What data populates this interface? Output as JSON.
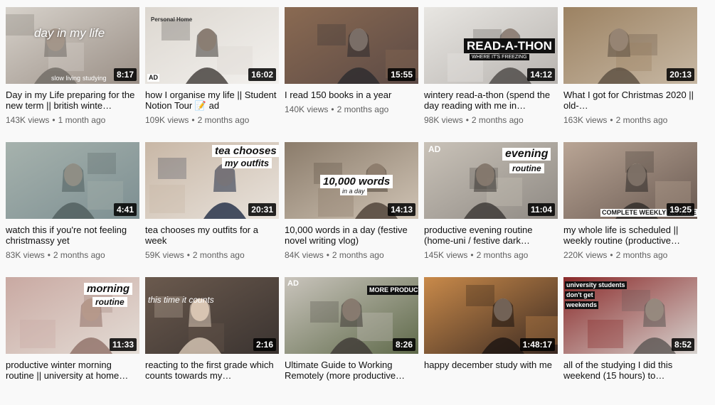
{
  "videos": [
    {
      "title": "Day in my Life preparing for the new term || british winte…",
      "views": "143K views",
      "age": "1 month ago",
      "duration": "8:17",
      "overlays": [
        "day in my life",
        "slow living",
        "studying"
      ],
      "palette": [
        "#9a8f86",
        "#d7d2cb",
        "#6f6a64"
      ]
    },
    {
      "title": "how I organise my life || Student Notion Tour 📝 ad",
      "views": "109K views",
      "age": "2 months ago",
      "duration": "16:02",
      "overlays": [
        "Personal Home",
        "AD"
      ],
      "palette": [
        "#f3f1ee",
        "#dcd7d0",
        "#3e3a36"
      ]
    },
    {
      "title": "I read 150 books in a year",
      "views": "140K views",
      "age": "2 months ago",
      "duration": "15:55",
      "overlays": [],
      "palette": [
        "#5c4a45",
        "#8a6a52",
        "#2c2a2e"
      ]
    },
    {
      "title": "wintery read-a-thon (spend the day reading with me in…",
      "views": "98K views",
      "age": "2 months ago",
      "duration": "14:12",
      "overlays": [
        "READ-A-THON",
        "WHERE IT'S FREEZING"
      ],
      "palette": [
        "#b8b4b0",
        "#e8e6e2",
        "#4a4644"
      ]
    },
    {
      "title": "What I got for Christmas 2020 || old-…",
      "views": "163K views",
      "age": "2 months ago",
      "duration": "20:13",
      "overlays": [],
      "palette": [
        "#c7b8a4",
        "#9c8262",
        "#5a4d40"
      ]
    },
    {
      "title": "watch this if you're not feeling christmassy yet",
      "views": "83K views",
      "age": "2 months ago",
      "duration": "4:41",
      "overlays": [],
      "palette": [
        "#7d8f92",
        "#a6b2ad",
        "#4f5d5c"
      ]
    },
    {
      "title": "tea chooses my outfits for a week",
      "views": "59K views",
      "age": "2 months ago",
      "duration": "20:31",
      "overlays": [
        "tea chooses",
        "my outfits"
      ],
      "palette": [
        "#e9e3dc",
        "#c8b7a6",
        "#1e2a44"
      ]
    },
    {
      "title": "10,000 words in a day (festive novel writing vlog)",
      "views": "84K views",
      "age": "2 months ago",
      "duration": "14:13",
      "overlays": [
        "10,000 words",
        "in a day"
      ],
      "palette": [
        "#cfc3b4",
        "#8b7c6b",
        "#4b3f35"
      ]
    },
    {
      "title": "productive evening routine (home-uni / festive dark…",
      "views": "145K views",
      "age": "2 months ago",
      "duration": "11:04",
      "overlays": [
        "AD",
        "evening",
        "routine"
      ],
      "palette": [
        "#8f8a84",
        "#c9c2b8",
        "#3a3633"
      ]
    },
    {
      "title": "my whole life is scheduled || weekly routine (productive…",
      "views": "220K views",
      "age": "2 months ago",
      "duration": "19:25",
      "overlays": [
        "COMPLETE WEEKLY ROUTINE"
      ],
      "palette": [
        "#6a5a52",
        "#b9a595",
        "#2e2a28"
      ]
    },
    {
      "title": "productive winter morning routine || university at home…",
      "views": "",
      "age": "",
      "duration": "11:33",
      "overlays": [
        "morning",
        "routine"
      ],
      "palette": [
        "#e4ddd6",
        "#c9a9a2",
        "#8f6f66"
      ]
    },
    {
      "title": "reacting to the first grade which counts towards my…",
      "views": "",
      "age": "",
      "duration": "2:16",
      "overlays": [
        "this time it counts"
      ],
      "palette": [
        "#3a3330",
        "#6b5a4e",
        "#d9c9b8"
      ]
    },
    {
      "title": "Ultimate Guide to Working Remotely (more productive…",
      "views": "",
      "age": "",
      "duration": "8:26",
      "overlays": [
        "AD",
        "MORE PRODUCTIVE?"
      ],
      "palette": [
        "#5f6a4a",
        "#c9c4bc",
        "#3f3a36"
      ]
    },
    {
      "title": "happy december study with me",
      "views": "",
      "age": "",
      "duration": "1:48:17",
      "overlays": [],
      "palette": [
        "#3b2a22",
        "#c98a4a",
        "#1c1411"
      ]
    },
    {
      "title": "all of the studying I did this weekend (15 hours) to…",
      "views": "",
      "age": "",
      "duration": "8:52",
      "overlays": [
        "university students",
        "don't get",
        "weekends"
      ],
      "palette": [
        "#d7d3cf",
        "#8a2a2a",
        "#5a5552"
      ]
    }
  ]
}
